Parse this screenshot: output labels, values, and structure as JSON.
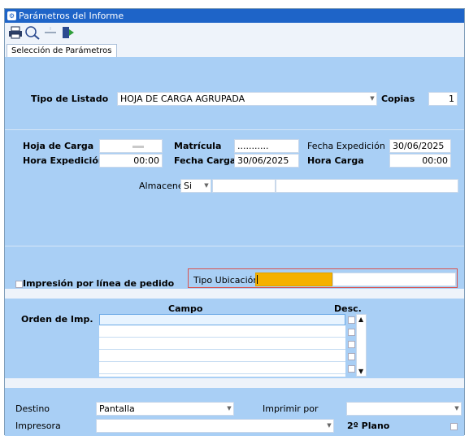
{
  "window": {
    "title": "Parámetros del Informe"
  },
  "toolbar": {
    "icons": [
      "printer-icon",
      "magnifier-icon",
      "minus-icon",
      "exit-door-icon"
    ]
  },
  "tabs": [
    {
      "label": "Selección de Parámetros"
    }
  ],
  "listado": {
    "tipo_label": "Tipo de Listado",
    "tipo_value": "HOJA DE CARGA AGRUPADA",
    "copias_label": "Copias",
    "copias_value": "1"
  },
  "carga": {
    "hoja_label": "Hoja de Carga",
    "matricula_label": "Matrícula",
    "matricula_value": "...........",
    "fecha_exp_label": "Fecha Expedición",
    "fecha_exp_value": "30/06/2025",
    "hora_exp_label": "Hora Expedición",
    "hora_exp_value": "00:00",
    "fecha_carga_label": "Fecha Carga",
    "fecha_carga_value": "30/06/2025",
    "hora_carga_label": "Hora Carga",
    "hora_carga_value": "00:00",
    "almacenes_label": "Almacenes",
    "almacenes_value": "Si"
  },
  "opciones": {
    "impresion_label": "Impresión por línea de pedido",
    "tipo_ubic_label": "Tipo Ubicación"
  },
  "orden": {
    "label": "Orden de Imp.",
    "col_campo": "Campo",
    "col_desc": "Desc."
  },
  "salida": {
    "destino_label": "Destino",
    "destino_value": "Pantalla",
    "imprimir_por_label": "Imprimir por",
    "impresora_label": "Impresora",
    "plano_label": "2º Plano"
  },
  "colors": {
    "titlebar": "#1e64c8",
    "panel": "#a9cff5",
    "highlight": "#f5b100",
    "focus_border": "#d9534f"
  }
}
